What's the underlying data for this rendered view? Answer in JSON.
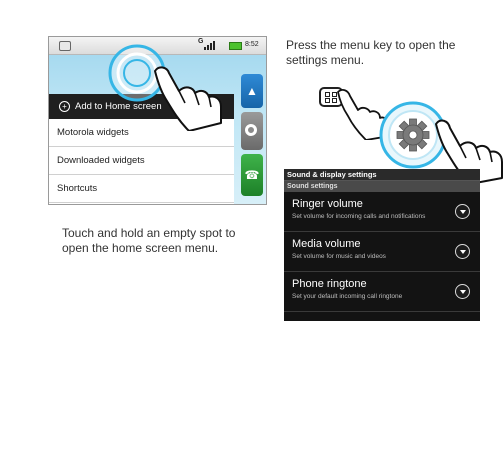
{
  "left_screen": {
    "status_bar": {
      "network": "G",
      "time": "8:52"
    },
    "home_menu": {
      "header": "Add to Home screen",
      "items": [
        "Motorola widgets",
        "Downloaded widgets",
        "Shortcuts"
      ]
    }
  },
  "captions": {
    "left": "Touch and hold an empty spot to open the home screen menu.",
    "right": "Press the menu key to open the settings menu."
  },
  "settings_screen": {
    "title": "Sound & display settings",
    "section": "Sound settings",
    "rows": [
      {
        "title": "Ringer volume",
        "subtitle": "Set volume for incoming calls and notifications"
      },
      {
        "title": "Media volume",
        "subtitle": "Set volume for music and videos"
      },
      {
        "title": "Phone ringtone",
        "subtitle": "Set your default incoming call ringtone"
      }
    ]
  },
  "colors": {
    "wallpaper": "#bfe6f5",
    "menu_header": "#1f1f1f",
    "settings_bg": "#131313",
    "highlight_ring": "#36b6e6",
    "contacts_button": "#1664a8",
    "phone_button": "#1d8028"
  },
  "icons": [
    "gear-icon",
    "menu-key-icon",
    "hand-pointer-icon",
    "contacts-icon",
    "launcher-icon",
    "phone-icon",
    "dropdown-arrow-icon"
  ]
}
